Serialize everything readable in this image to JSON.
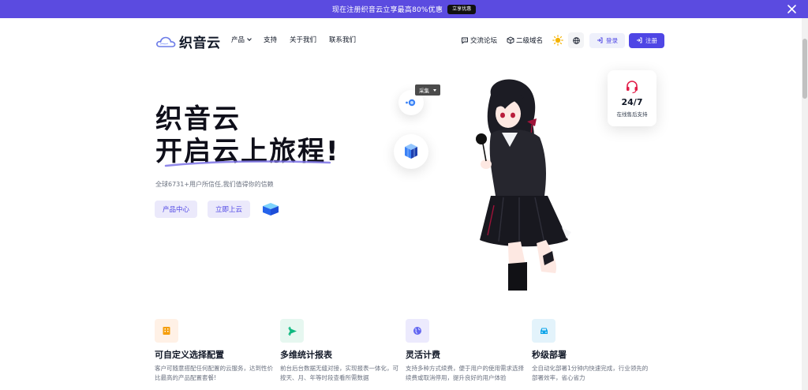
{
  "promo": {
    "text": "现在注册织音云立享最高80%优惠",
    "button": "立享优惠"
  },
  "header": {
    "brand": "织音云",
    "nav": [
      {
        "label": "产品"
      },
      {
        "label": "支持"
      },
      {
        "label": "关于我们"
      },
      {
        "label": "联系我们"
      }
    ],
    "forum": "交流论坛",
    "subdomain": "二级域名",
    "login": "登录",
    "register": "注册"
  },
  "hero": {
    "title_line1": "织音云",
    "title_line2": "开启云上旅程!",
    "subtitle": "全球6731+用户所信任,我们值得你的信赖",
    "btn_products": "产品中心",
    "btn_cloud": "立即上云",
    "tooltip": "采集"
  },
  "support": {
    "big": "24/7",
    "small": "在线售后支持"
  },
  "features": [
    {
      "title": "可自定义选择配置",
      "desc": "客户可随意搭配任何配置的云服务，达到性价比最高的产品配置套餐!",
      "color": "#f59e0b",
      "bg": "#fff1e6"
    },
    {
      "title": "多维统计报表",
      "desc": "前台后台数据无缝对接，实现报表一体化，可按天、月、年等时段查看所需数据",
      "color": "#10b981",
      "bg": "#e6f7f0"
    },
    {
      "title": "灵活计费",
      "desc": "支持多种方式续费，便于用户的使用需求选择续费或取消停用，提升良好的用户体验",
      "color": "#6366f1",
      "bg": "#eceafd"
    },
    {
      "title": "秒级部署",
      "desc": "全自动化部署1分钟内快速完成，行业领先的部署效率，省心省力",
      "color": "#0ea5e9",
      "bg": "#e3f3fb"
    }
  ],
  "colors": {
    "primary": "#4f46e5",
    "banner": "#5b4be0"
  }
}
